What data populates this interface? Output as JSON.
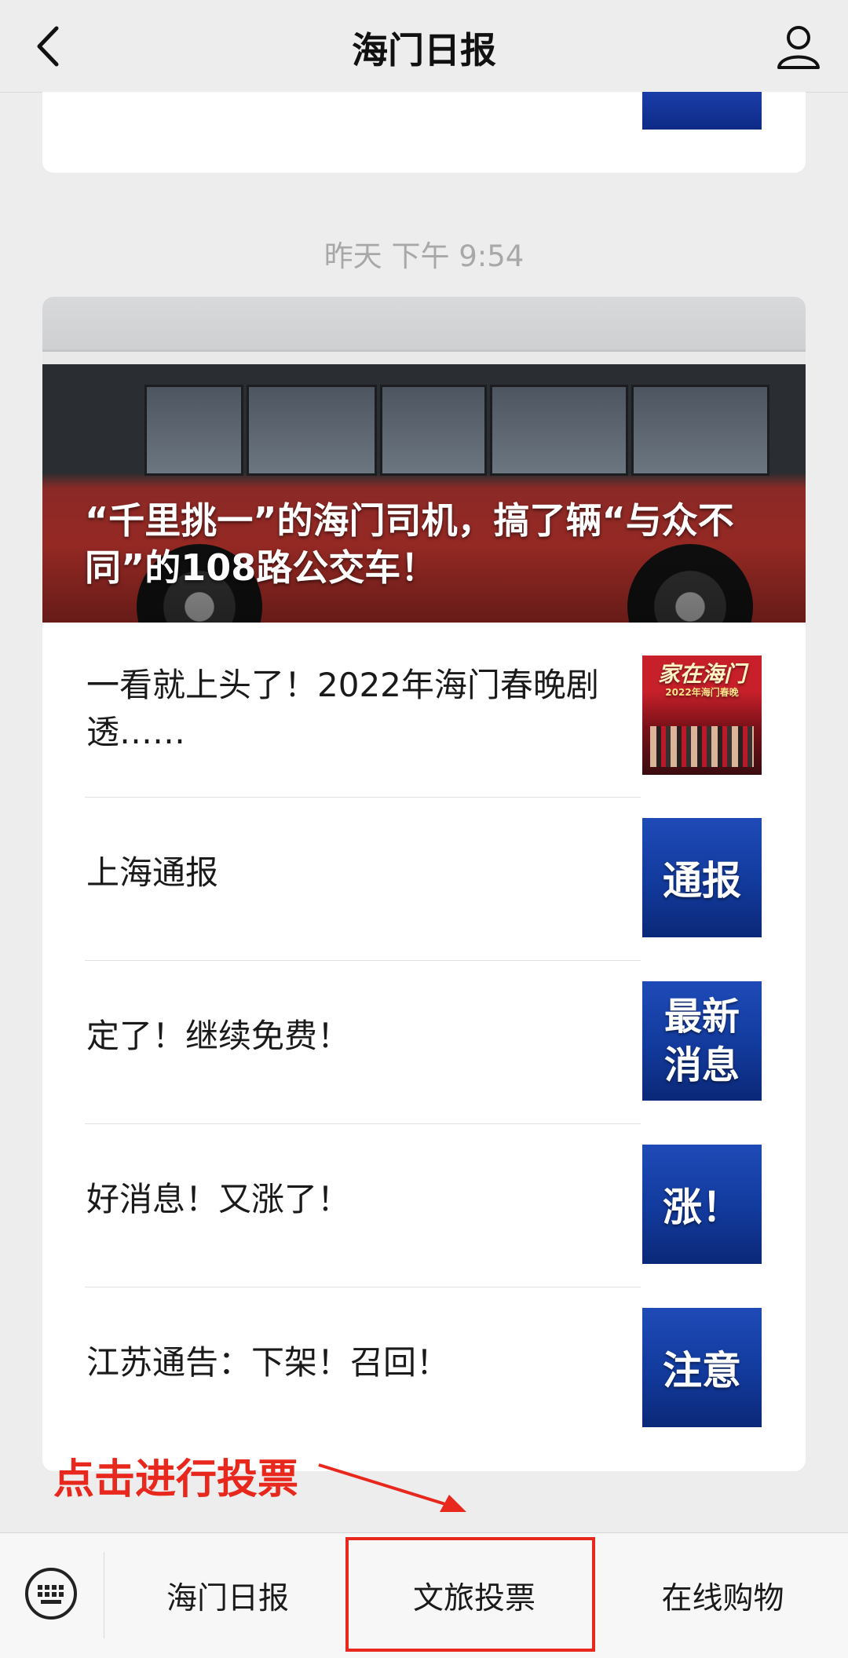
{
  "header": {
    "title": "海门日报",
    "back_icon": "chevron-left-icon",
    "profile_icon": "person-icon"
  },
  "timestamp": "昨天 下午 9:54",
  "hero": {
    "title": "“千里挑一”的海门司机，搞了辆“与众不同”的108路公交车！"
  },
  "articles": [
    {
      "title": "一看就上头了！2022年海门春晚剧透……",
      "thumb_title": "家在海门",
      "thumb_subtitle": "2022年海门春晚"
    },
    {
      "title": "上海通报",
      "thumb_text": "通报"
    },
    {
      "title": "定了！继续免费！",
      "thumb_text": "最新消息"
    },
    {
      "title": "好消息！又涨了！",
      "thumb_text": "涨！"
    },
    {
      "title": "江苏通告：下架！召回！",
      "thumb_text": "注意"
    }
  ],
  "annotation": {
    "text": "点击进行投票",
    "color": "#e8271d"
  },
  "menu": {
    "keyboard_icon": "keyboard-icon",
    "items": [
      "海门日报",
      "文旅投票",
      "在线购物"
    ]
  }
}
